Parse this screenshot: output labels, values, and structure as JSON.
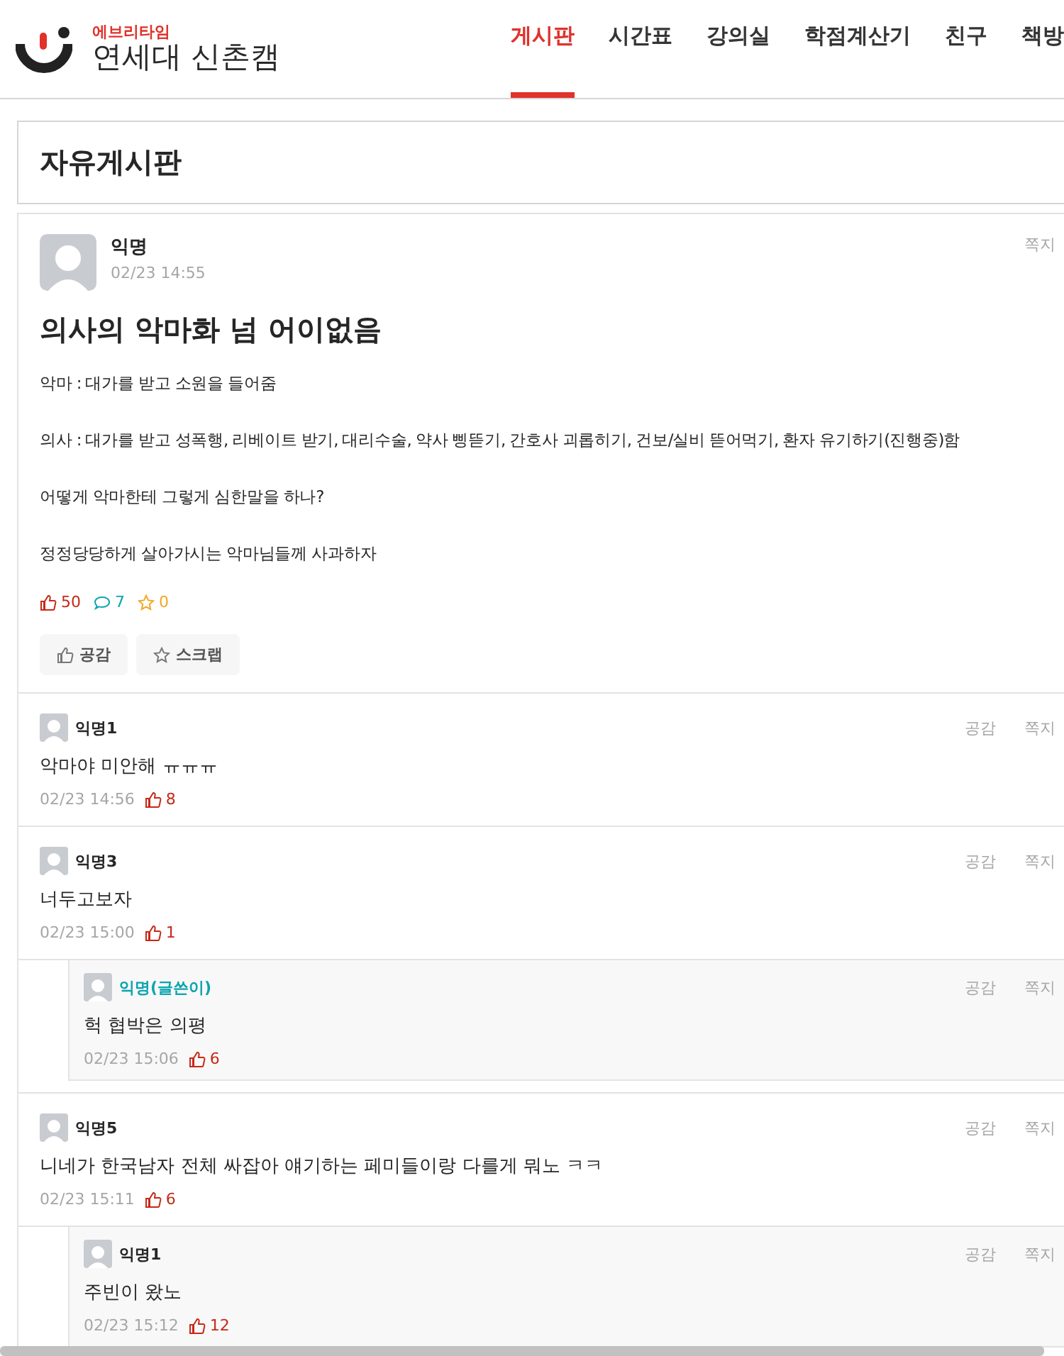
{
  "header": {
    "brand": "에브리타임",
    "campus": "연세대 신촌캠"
  },
  "nav": [
    {
      "label": "게시판",
      "selected": true
    },
    {
      "label": "시간표",
      "selected": false
    },
    {
      "label": "강의실",
      "selected": false
    },
    {
      "label": "학점계산기",
      "selected": false
    },
    {
      "label": "친구",
      "selected": false
    },
    {
      "label": "책방",
      "selected": false
    }
  ],
  "board": {
    "title": "자유게시판"
  },
  "post": {
    "author": "익명",
    "time": "02/23 14:55",
    "message": "쪽지",
    "title": "의사의 악마화 넘 어이없음",
    "paragraphs": [
      "악마 : 대가를 받고 소원을 들어줌",
      "의사 : 대가를 받고 성폭행, 리베이트 받기, 대리수술, 약사 삥뜯기, 간호사 괴롭히기, 건보/실비 뜯어먹기, 환자 유기하기(진행중)함",
      "어떻게 악마한테 그렇게 심한말을 하나?",
      "정정당당하게 살아가시는 악마님들께 사과하자"
    ],
    "likes": "50",
    "comments": "7",
    "scraps": "0",
    "buttons": [
      {
        "kind": "like",
        "label": "공감"
      },
      {
        "kind": "scrap",
        "label": "스크랩"
      }
    ]
  },
  "comments": [
    {
      "author": "익명1",
      "writer": false,
      "text": "악마야 미안해 ㅠㅠㅠ",
      "time": "02/23 14:56",
      "likes": "8",
      "actions": [
        "공감",
        "쪽지"
      ]
    },
    {
      "author": "익명3",
      "writer": false,
      "text": "너두고보자",
      "time": "02/23 15:00",
      "likes": "1",
      "actions": [
        "공감",
        "쪽지"
      ],
      "children": [
        {
          "author": "익명(글쓴이)",
          "writer": true,
          "text": "헉 협박은 의평",
          "time": "02/23 15:06",
          "likes": "6",
          "actions": [
            "공감",
            "쪽지"
          ]
        }
      ]
    },
    {
      "author": "익명5",
      "writer": false,
      "text": "니네가 한국남자 전체 싸잡아 얘기하는 페미들이랑 다를게 뭐노 ㅋㅋ",
      "time": "02/23 15:11",
      "likes": "6",
      "actions": [
        "공감",
        "쪽지"
      ],
      "children": [
        {
          "author": "익명1",
          "writer": false,
          "text": "주빈이 왔노",
          "time": "02/23 15:12",
          "likes": "12",
          "actions": [
            "공감",
            "쪽지"
          ]
        }
      ]
    }
  ]
}
